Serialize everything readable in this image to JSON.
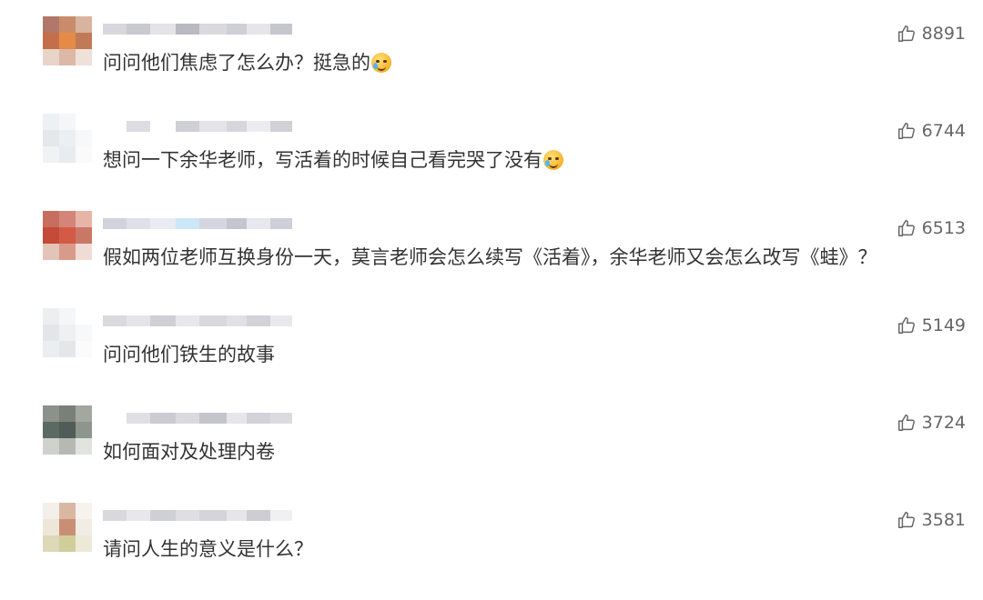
{
  "comments": [
    {
      "text": "问问他们焦虑了怎么办？挺急的",
      "emoji": "laugh-cry-emoji-icon",
      "likes": "8891",
      "avatar_colors": [
        "#b0776a",
        "#c98c6a",
        "#d8b39d",
        "#c46f4a",
        "#e58b47",
        "#c07a57",
        "#e8d4c8",
        "#dcb9a6",
        "#efe1d8"
      ],
      "username_colors": [
        "#d7d7dd",
        "#c9c9d0",
        "#e3e3e8",
        "#b9b9c2",
        "#d9d9de",
        "#cfcfd6",
        "#e6e6ea",
        "#c6c6cd"
      ]
    },
    {
      "text": "想问一下余华老师，写活着的时候自己看完哭了没有",
      "emoji": "crying-emoji-icon",
      "likes": "6744",
      "avatar_colors": [
        "#eef1f3",
        "#f4f6f7",
        "#ffffff",
        "#e4e8eb",
        "#eceff1",
        "#f7f8f9",
        "#f0f2f4",
        "#e9ecef",
        "#fafafa"
      ],
      "username_colors": [
        "#ffffff",
        "#dcdce2",
        "#ffffff",
        "#cfd0d6",
        "#e3e3e8",
        "#d6d6dc",
        "#ececf0",
        "#d0d0d6"
      ]
    },
    {
      "text": "假如两位老师互换身份一天，莫言老师会怎么续写《活着》，余华老师又会怎么改写《蛙》？",
      "emoji": "",
      "likes": "6513",
      "avatar_colors": [
        "#c76e5f",
        "#d4857a",
        "#e6b5a8",
        "#c44a3a",
        "#d35b45",
        "#c97865",
        "#e4c3b8",
        "#d99a8a",
        "#f0dcd4"
      ],
      "username_colors": [
        "#cfd3dc",
        "#dfe1e8",
        "#e9ecf3",
        "#cbe6f7",
        "#d4d7df",
        "#c2c6cf",
        "#e6e8ee",
        "#cdd0d8"
      ]
    },
    {
      "text": "问问他们铁生的故事",
      "emoji": "",
      "likes": "5149",
      "avatar_colors": [
        "#eceef0",
        "#f5f6f7",
        "#ffffff",
        "#e3e6e9",
        "#eef0f2",
        "#f7f8f9",
        "#ebedef",
        "#e4e7ea",
        "#fbfbfb"
      ],
      "username_colors": [
        "#dadade",
        "#e5e5e9",
        "#cfcfd5",
        "#e8e8ec",
        "#d8d8dd",
        "#e1e1e5",
        "#d2d2d8",
        "#e9e9ed"
      ]
    },
    {
      "text": "如何面对及处理内卷",
      "emoji": "",
      "likes": "3724",
      "avatar_colors": [
        "#8c9189",
        "#7a8078",
        "#a2a7a0",
        "#5d6a63",
        "#4f5c57",
        "#8e958c",
        "#cfd2cc",
        "#b5b9b2",
        "#e1e3df"
      ],
      "username_colors": [
        "#ffffff",
        "#e0e0e4",
        "#cbcbd1",
        "#dadade",
        "#c4c4cb",
        "#e6e6ea",
        "#d2d2d8",
        "#dcdce0"
      ]
    },
    {
      "text": "请问人生的意义是什么？",
      "emoji": "",
      "likes": "3581",
      "avatar_colors": [
        "#f3efe9",
        "#d9b8a3",
        "#f6f3ee",
        "#efe6da",
        "#c98f75",
        "#f1ece4",
        "#dcd8b8",
        "#d0cf9c",
        "#ece9d6"
      ],
      "username_colors": [
        "#d8d8dd",
        "#e8e8ec",
        "#cfd0d6",
        "#dedee3",
        "#d4d4da",
        "#e6e6ea",
        "#cdcdd3",
        "#f0f0f2"
      ]
    }
  ]
}
